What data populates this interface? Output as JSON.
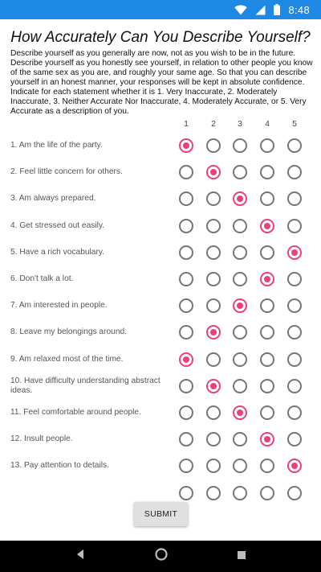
{
  "status_bar": {
    "time": "8:48"
  },
  "survey": {
    "title": "How Accurately Can You Describe Yourself?",
    "description": "Describe yourself as you generally are now, not as you wish to be in the future. Describe yourself as you honestly see yourself, in relation to other people you know of the same sex as you are, and roughly your same age. So that you can describe yourself in an honest manner, your responses will be kept in absolute confidence. Indicate for each statement whether it is 1. Very Inaccurate, 2. Moderately Inaccurate, 3. Neither Accurate Nor Inaccurate, 4. Moderately Accurate, or 5. Very Accurate as a description of you.",
    "scale": [
      "1",
      "2",
      "3",
      "4",
      "5"
    ],
    "questions": [
      {
        "label": "1. Am the life of the party.",
        "selected": 1
      },
      {
        "label": "2. Feel little concern for others.",
        "selected": 2
      },
      {
        "label": "3. Am always prepared.",
        "selected": 3
      },
      {
        "label": "4. Get stressed out easily.",
        "selected": 4
      },
      {
        "label": "5. Have a rich vocabulary.",
        "selected": 5
      },
      {
        "label": "6. Don't talk a lot.",
        "selected": 4
      },
      {
        "label": "7. Am interested in people.",
        "selected": 3
      },
      {
        "label": "8. Leave my belongings around.",
        "selected": 2
      },
      {
        "label": "9. Am relaxed most of the time.",
        "selected": 1
      },
      {
        "label": "10. Have difficulty understanding abstract ideas.",
        "selected": 2
      },
      {
        "label": "11. Feel comfortable around people.",
        "selected": 3
      },
      {
        "label": "12. Insult people.",
        "selected": 4
      },
      {
        "label": "13. Pay attention to details.",
        "selected": 5
      },
      {
        "label": "",
        "selected": 0
      }
    ],
    "submit_label": "SUBMIT"
  },
  "colors": {
    "status_bar": "#1e88e5",
    "radio_selected": "#ec407a",
    "radio_unselected": "#757575"
  },
  "icons": {
    "status": [
      "wifi-icon",
      "signal-icon",
      "battery-icon"
    ],
    "nav": [
      "back-icon",
      "home-icon",
      "recents-icon"
    ]
  }
}
